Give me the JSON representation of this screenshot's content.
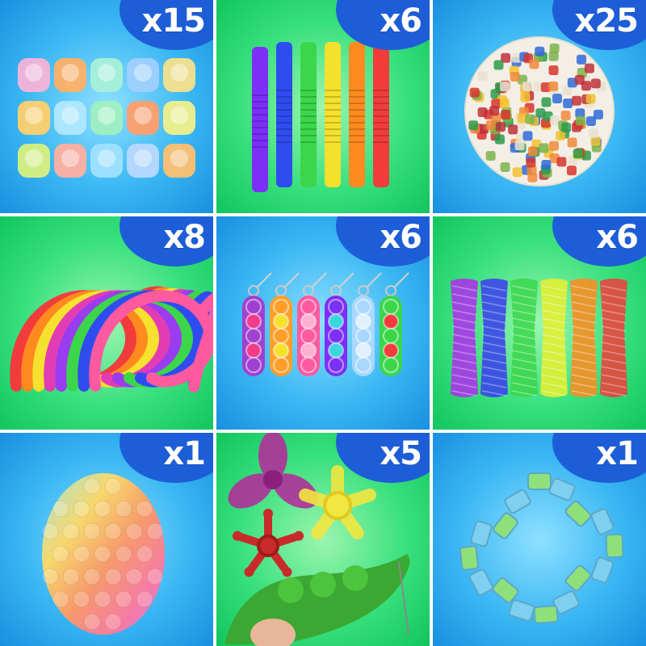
{
  "tiles": [
    {
      "count": "x15",
      "item": "finger-ring-pop",
      "bg": "blue"
    },
    {
      "count": "x6",
      "item": "pop-tubes",
      "bg": "green"
    },
    {
      "count": "x25",
      "item": "christmas-stickers",
      "bg": "blue"
    },
    {
      "count": "x8",
      "item": "stretchy-strings",
      "bg": "green"
    },
    {
      "count": "x6",
      "item": "pop-keychains",
      "bg": "blue"
    },
    {
      "count": "x6",
      "item": "marble-mesh-tubes",
      "bg": "green"
    },
    {
      "count": "x1",
      "item": "pop-ball",
      "bg": "blue"
    },
    {
      "count": "x5",
      "item": "spinners-and-pea-pod",
      "bg": "green"
    },
    {
      "count": "x1",
      "item": "wacky-track",
      "bg": "blue"
    }
  ],
  "colors": {
    "badge": "#1d5ed8",
    "tile_blue": "#3ab7f3",
    "tile_green": "#39e07e",
    "rainbow": [
      "#7b2ff7",
      "#2f4cf0",
      "#3bd64a",
      "#f5e12e",
      "#ff8a1f",
      "#f23c3c"
    ]
  }
}
